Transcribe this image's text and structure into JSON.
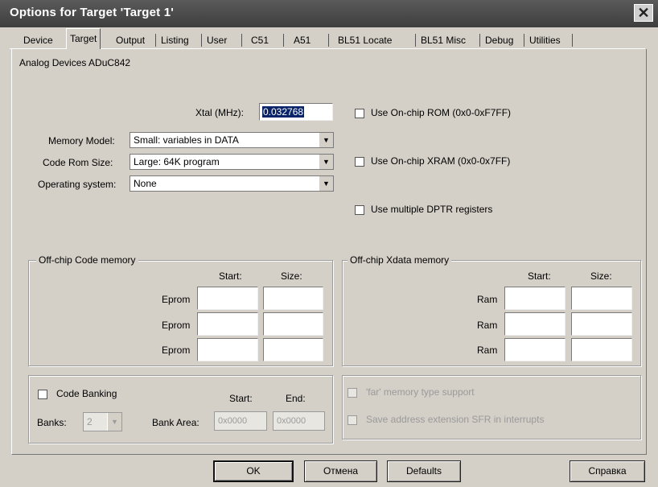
{
  "window": {
    "title": "Options for Target 'Target 1'"
  },
  "tabs": [
    "Device",
    "Target",
    "Output",
    "Listing",
    "User",
    "C51",
    "A51",
    "BL51 Locate",
    "BL51 Misc",
    "Debug",
    "Utilities"
  ],
  "device_name": "Analog Devices ADuC842",
  "xtal": {
    "label": "Xtal (MHz):",
    "value": "0.032768"
  },
  "memory_model": {
    "label": "Memory Model:",
    "value": "Small: variables in DATA"
  },
  "code_rom_size": {
    "label": "Code Rom Size:",
    "value": "Large: 64K program"
  },
  "operating_system": {
    "label": "Operating system:",
    "value": "None"
  },
  "options": {
    "onchip_rom": "Use On-chip ROM (0x0-0xF7FF)",
    "onchip_xram": "Use On-chip XRAM (0x0-0x7FF)",
    "multiple_dptr": "Use multiple DPTR registers"
  },
  "code_memory": {
    "title": "Off-chip Code memory",
    "start_header": "Start:",
    "size_header": "Size:",
    "rows": [
      "Eprom",
      "Eprom",
      "Eprom"
    ]
  },
  "xdata_memory": {
    "title": "Off-chip Xdata memory",
    "start_header": "Start:",
    "size_header": "Size:",
    "rows": [
      "Ram",
      "Ram",
      "Ram"
    ]
  },
  "banking": {
    "checkbox_label": "Code Banking",
    "banks_label": "Banks:",
    "banks_value": "2",
    "start_header": "Start:",
    "end_header": "End:",
    "bank_area_label": "Bank Area:",
    "start_value": "0x0000",
    "end_value": "0x0000"
  },
  "far": {
    "far_memory": "'far' memory type support",
    "save_address": "Save address extension SFR in interrupts"
  },
  "buttons": {
    "ok": "OK",
    "cancel": "Отмена",
    "defaults": "Defaults",
    "help": "Справка"
  },
  "colors": {
    "titlebar": "#4a4a4a",
    "face": "#d4d0c8",
    "selection": "#0a246a"
  }
}
